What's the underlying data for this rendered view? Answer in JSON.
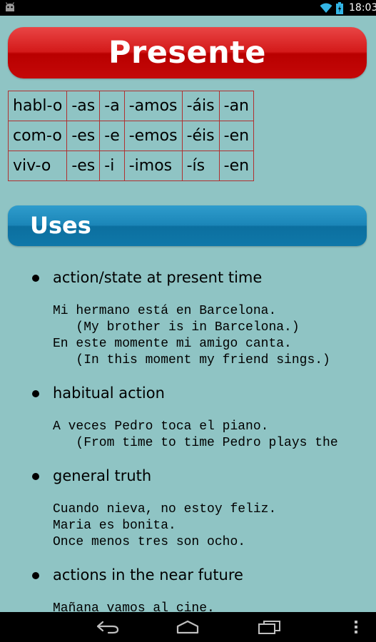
{
  "status_bar": {
    "time": "18:03"
  },
  "title": "Presente",
  "conjugation_table": [
    [
      "habl-o",
      "-as",
      "-a",
      "-amos",
      "-áis",
      "-an"
    ],
    [
      "com-o",
      "-es",
      "-e",
      "-emos",
      "-éis",
      "-en"
    ],
    [
      "viv-o",
      "-es",
      "-i",
      "-imos",
      "-ís",
      "-en"
    ]
  ],
  "uses_heading": "Uses",
  "uses": [
    {
      "label": "action/state at present time",
      "examples": [
        "Mi hermano está en Barcelona.",
        "   (My brother is in Barcelona.)",
        "En este momente mi amigo canta.",
        "   (In this moment my friend sings.)"
      ]
    },
    {
      "label": "habitual action",
      "examples": [
        "A veces Pedro toca el piano.",
        "   (From time to time Pedro plays the"
      ]
    },
    {
      "label": "general truth",
      "examples": [
        "Cuando nieva, no estoy feliz.",
        "Maria es bonita.",
        "Once menos tres son ocho."
      ]
    },
    {
      "label": "actions in the near future",
      "examples": [
        "Mañana vamos al cine."
      ]
    }
  ],
  "icons": {
    "status": [
      "android-icon",
      "wifi-icon",
      "battery-icon"
    ],
    "navigation": [
      "back-icon",
      "home-icon",
      "recent-apps-icon"
    ]
  }
}
